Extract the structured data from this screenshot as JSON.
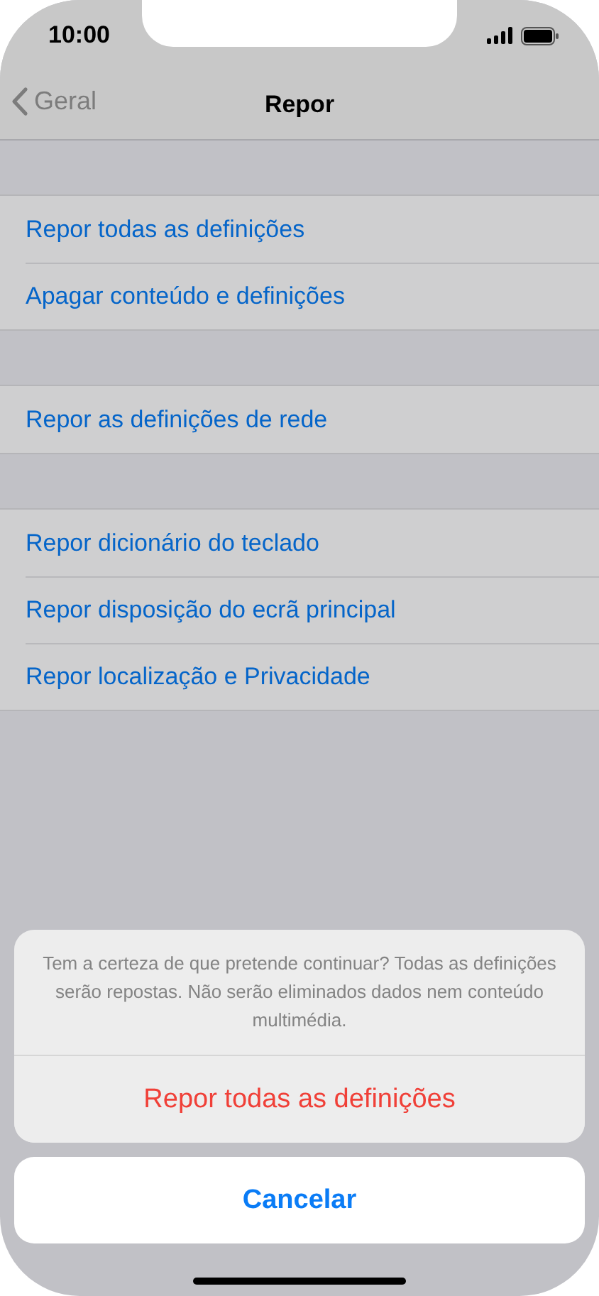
{
  "status_bar": {
    "time": "10:00"
  },
  "nav": {
    "back": "Geral",
    "title": "Repor"
  },
  "groups": [
    {
      "items": [
        "Repor todas as definições",
        "Apagar conteúdo e definições"
      ]
    },
    {
      "items": [
        "Repor as definições de rede"
      ]
    },
    {
      "items": [
        "Repor dicionário do teclado",
        "Repor disposição do ecrã principal",
        "Repor localização e Privacidade"
      ]
    }
  ],
  "action_sheet": {
    "message": "Tem a certeza de que pretende continuar? Todas as definições serão repostas. Não serão eliminados dados nem conteúdo multimédia.",
    "action": "Repor todas as definições",
    "cancel": "Cancelar"
  }
}
